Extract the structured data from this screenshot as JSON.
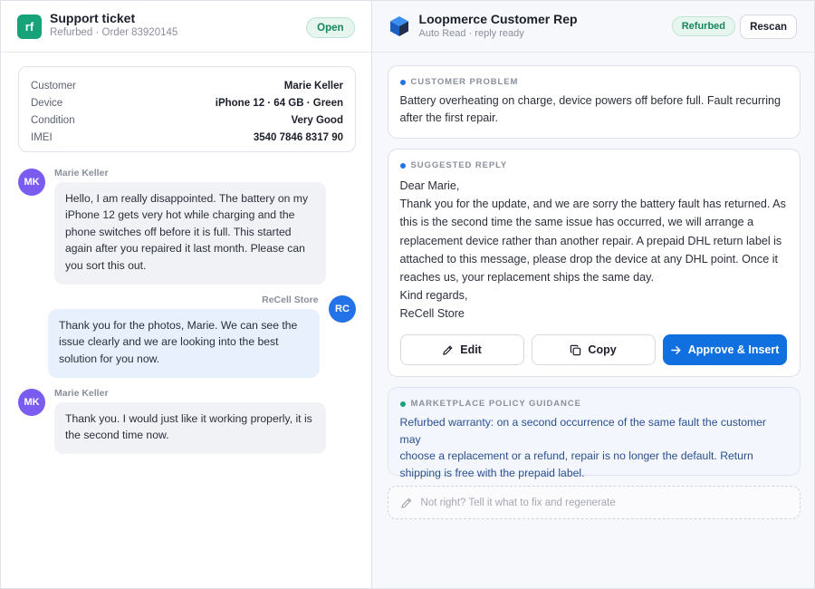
{
  "ticket": {
    "logo_text": "rf",
    "title": "Support ticket",
    "subtitle": "Refurbed · Order 83920145",
    "status": "Open"
  },
  "details": [
    {
      "key": "Customer",
      "value": "Marie Keller"
    },
    {
      "key": "Device",
      "value": "iPhone 12 · 64 GB · Green"
    },
    {
      "key": "Condition",
      "value": "Very Good"
    },
    {
      "key": "IMEI",
      "value": "3540 7846 8317 90"
    }
  ],
  "messages": [
    {
      "sender": "Marie Keller",
      "initials": "MK",
      "lines": [
        "Hello, I am really disappointed. The battery on my",
        "iPhone 12 gets very hot while charging and the",
        "phone switches off before it is full. This started",
        "again after you repaired it last month. Please can",
        "you sort this out."
      ]
    },
    {
      "sender": "ReCell Store",
      "initials": "RC",
      "lines": [
        "Thank you for the photos, Marie. We can see the",
        "issue clearly and we are looking into the best",
        "solution for you now."
      ]
    },
    {
      "sender": "Marie Keller",
      "initials": "MK",
      "lines": [
        "Thank you. I would just like it working properly, it is",
        "the second time now."
      ]
    }
  ],
  "assistant": {
    "title": "Loopmerce Customer Rep",
    "subtitle": "Auto Read · reply ready",
    "marketplace_badge": "Refurbed",
    "rescan_label": "Rescan",
    "brand_color": "#1170e0"
  },
  "problem": {
    "label": "CUSTOMER PROBLEM",
    "lines": [
      "Battery overheating on charge, device powers off before full. Fault recurring",
      "after the first repair."
    ]
  },
  "reply": {
    "label": "SUGGESTED REPLY",
    "lines": [
      "Dear Marie,",
      "Thank you for the update, and we are sorry the battery fault has returned. As",
      "this is the second time the same issue has occurred, we will arrange a",
      "replacement device rather than another repair. A prepaid DHL return label is",
      "attached to this message, please drop the device at any DHL point. Once it",
      "reaches us, your replacement ships the same day.",
      "Kind regards,",
      "ReCell Store"
    ],
    "edit_label": "Edit",
    "copy_label": "Copy",
    "approve_label": "Approve & Insert"
  },
  "policy": {
    "label": "MARKETPLACE POLICY GUIDANCE",
    "lines": [
      "Refurbed warranty: on a second occurrence of the same fault the customer may",
      "choose a replacement or a refund, repair is no longer the default. Return",
      "shipping is free with the prepaid label."
    ]
  },
  "regenerate": {
    "placeholder": "Not right? Tell it what to fix and regenerate"
  }
}
